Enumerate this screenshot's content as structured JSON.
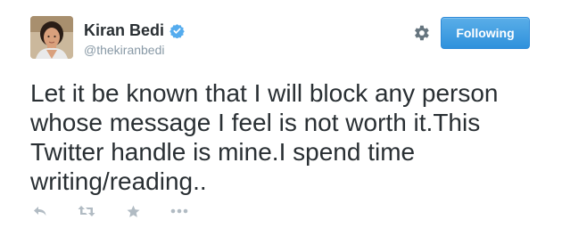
{
  "tweet": {
    "display_name": "Kiran Bedi",
    "username": "@thekiranbedi",
    "follow_button_label": "Following",
    "text": "Let it be known that I will block any person\nwhose message I feel is not worth it.This\nTwitter handle is mine.I spend time\nwriting/reading..",
    "verified": true
  },
  "colors": {
    "accent": "#55acee",
    "username": "#8899a6",
    "action_icons": "#b1bbc3",
    "text": "#292f33"
  },
  "icons": {
    "verified": "verified-badge-icon",
    "settings": "gear-icon",
    "reply": "reply-icon",
    "retweet": "retweet-icon",
    "favorite": "star-icon",
    "more": "more-icon"
  }
}
